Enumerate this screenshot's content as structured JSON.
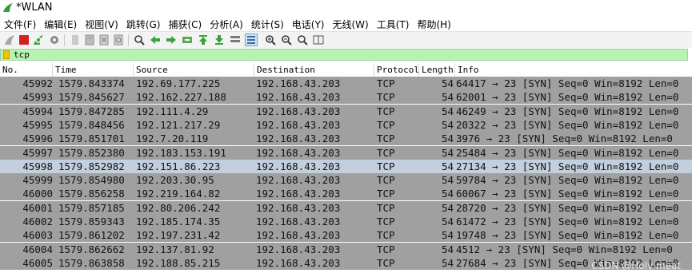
{
  "window": {
    "title": "*WLAN"
  },
  "menu": [
    "文件(F)",
    "编辑(E)",
    "视图(V)",
    "跳转(G)",
    "捕获(C)",
    "分析(A)",
    "统计(S)",
    "电话(Y)",
    "无线(W)",
    "工具(T)",
    "帮助(H)"
  ],
  "toolbar_icons": [
    "shark-fin-start-icon",
    "stop-icon",
    "restart-icon",
    "options-gear-icon",
    "open-file-icon",
    "save-file-icon",
    "close-file-icon",
    "reload-icon",
    "find-icon",
    "back-arrow-icon",
    "forward-arrow-icon",
    "goto-packet-icon",
    "first-packet-icon",
    "last-packet-icon",
    "autoscroll-icon",
    "colorize-icon",
    "zoom-in-icon",
    "zoom-out-icon",
    "zoom-normal-icon",
    "resize-columns-icon"
  ],
  "filter": {
    "value": "tcp"
  },
  "columns": [
    "No.",
    "Time",
    "Source",
    "Destination",
    "Protocol",
    "Length",
    "Info"
  ],
  "packets": [
    {
      "no": "45992",
      "time": "1579.843374",
      "src": "192.69.177.225",
      "dst": "192.168.43.203",
      "proto": "TCP",
      "len": "54",
      "info": "64417 → 23 [SYN] Seq=0 Win=8192 Len=0"
    },
    {
      "no": "45993",
      "time": "1579.845627",
      "src": "192.162.227.188",
      "dst": "192.168.43.203",
      "proto": "TCP",
      "len": "54",
      "info": "62001 → 23 [SYN] Seq=0 Win=8192 Len=0"
    },
    {
      "no": "45994",
      "time": "1579.847285",
      "src": "192.111.4.29",
      "dst": "192.168.43.203",
      "proto": "TCP",
      "len": "54",
      "info": "46249 → 23 [SYN] Seq=0 Win=8192 Len=0"
    },
    {
      "no": "45995",
      "time": "1579.848456",
      "src": "192.121.217.29",
      "dst": "192.168.43.203",
      "proto": "TCP",
      "len": "54",
      "info": "20322 → 23 [SYN] Seq=0 Win=8192 Len=0"
    },
    {
      "no": "45996",
      "time": "1579.851701",
      "src": "192.7.20.119",
      "dst": "192.168.43.203",
      "proto": "TCP",
      "len": "54",
      "info": "3976 → 23 [SYN] Seq=0 Win=8192 Len=0"
    },
    {
      "no": "45997",
      "time": "1579.852380",
      "src": "192.183.153.191",
      "dst": "192.168.43.203",
      "proto": "TCP",
      "len": "54",
      "info": "25484 → 23 [SYN] Seq=0 Win=8192 Len=0"
    },
    {
      "no": "45998",
      "time": "1579.852982",
      "src": "192.151.86.223",
      "dst": "192.168.43.203",
      "proto": "TCP",
      "len": "54",
      "info": "27134 → 23 [SYN] Seq=0 Win=8192 Len=0",
      "selected": true
    },
    {
      "no": "45999",
      "time": "1579.854980",
      "src": "192.203.30.95",
      "dst": "192.168.43.203",
      "proto": "TCP",
      "len": "54",
      "info": "59784 → 23 [SYN] Seq=0 Win=8192 Len=0"
    },
    {
      "no": "46000",
      "time": "1579.856258",
      "src": "192.219.164.82",
      "dst": "192.168.43.203",
      "proto": "TCP",
      "len": "54",
      "info": "60067 → 23 [SYN] Seq=0 Win=8192 Len=0"
    },
    {
      "no": "46001",
      "time": "1579.857185",
      "src": "192.80.206.242",
      "dst": "192.168.43.203",
      "proto": "TCP",
      "len": "54",
      "info": "28720 → 23 [SYN] Seq=0 Win=8192 Len=0"
    },
    {
      "no": "46002",
      "time": "1579.859343",
      "src": "192.185.174.35",
      "dst": "192.168.43.203",
      "proto": "TCP",
      "len": "54",
      "info": "61472 → 23 [SYN] Seq=0 Win=8192 Len=0"
    },
    {
      "no": "46003",
      "time": "1579.861202",
      "src": "192.197.231.42",
      "dst": "192.168.43.203",
      "proto": "TCP",
      "len": "54",
      "info": "19748 → 23 [SYN] Seq=0 Win=8192 Len=0"
    },
    {
      "no": "46004",
      "time": "1579.862662",
      "src": "192.137.81.92",
      "dst": "192.168.43.203",
      "proto": "TCP",
      "len": "54",
      "info": "4512 → 23 [SYN] Seq=0 Win=8192 Len=0"
    },
    {
      "no": "46005",
      "time": "1579.863858",
      "src": "192.188.85.215",
      "dst": "192.168.43.203",
      "proto": "TCP",
      "len": "54",
      "info": "27684 → 23 [SYN] Seq=0 Win=8192 Len=0"
    }
  ],
  "watermark": "CSDN @Holy meat"
}
